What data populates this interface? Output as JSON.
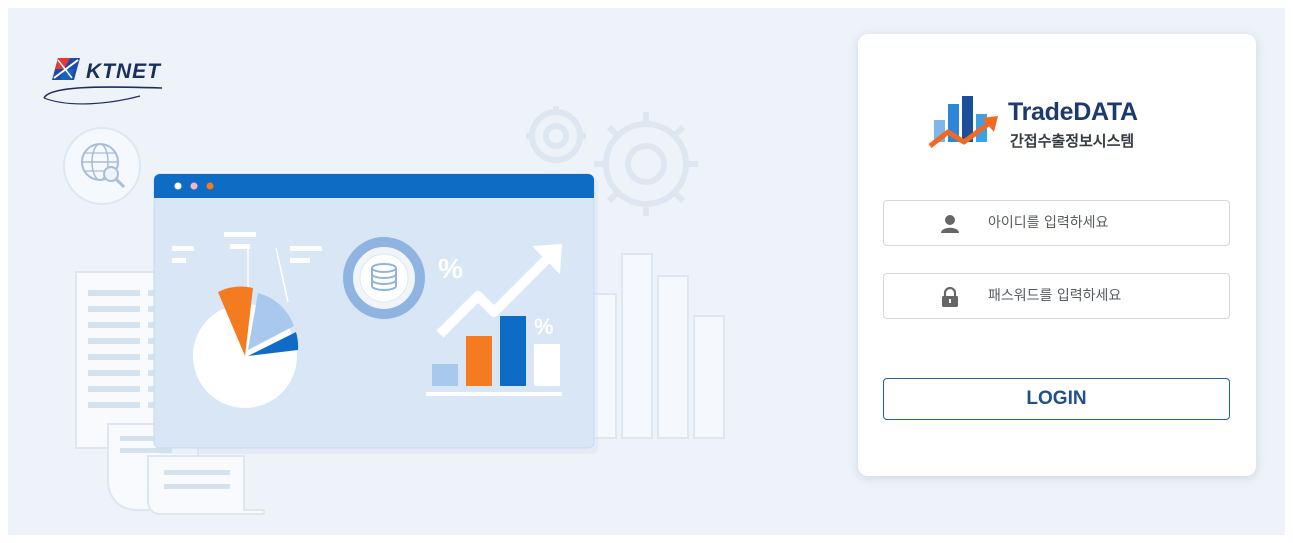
{
  "header": {
    "logo_text": "KTNET"
  },
  "brand": {
    "name": "TradeDATA",
    "subtitle": "간접수출정보시스템"
  },
  "login_form": {
    "id_placeholder": "아이디를 입력하세요",
    "password_placeholder": "패스워드를 입력하세요",
    "login_label": "LOGIN"
  },
  "illustration": {
    "percent_1": "%",
    "percent_2": "%"
  },
  "colors": {
    "accent_blue": "#0f6cc4",
    "orange": "#f47b20",
    "navy": "#1c3a6e",
    "bg": "#eef3f9"
  },
  "icons": [
    "ktnet-logo-icon",
    "globe-search-icon",
    "gear-icon",
    "database-icon",
    "trend-arrow-icon",
    "user-icon",
    "lock-icon",
    "tradedata-logo-icon"
  ]
}
